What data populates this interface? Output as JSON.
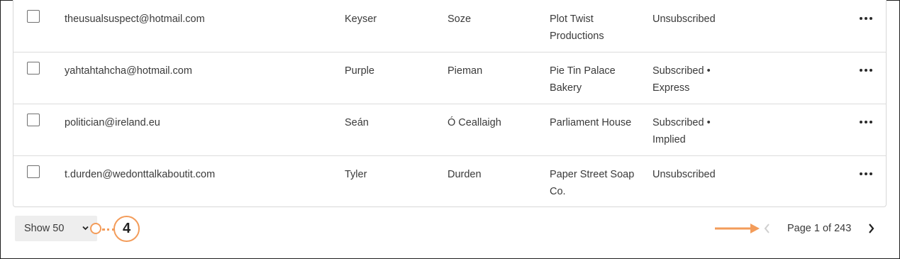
{
  "rows": [
    {
      "email": "theusualsuspect@hotmail.com",
      "first_name": "Keyser",
      "last_name": "Soze",
      "company": "Plot Twist Productions",
      "status": "Unsubscribed"
    },
    {
      "email": "yahtahtahcha@hotmail.com",
      "first_name": "Purple",
      "last_name": "Pieman",
      "company": "Pie Tin Palace Bakery",
      "status": "Subscribed • Express"
    },
    {
      "email": "politician@ireland.eu",
      "first_name": "Seán",
      "last_name": "Ó Ceallaigh",
      "company": "Parliament House",
      "status": "Subscribed • Implied"
    },
    {
      "email": "t.durden@wedonttalkaboutit.com",
      "first_name": "Tyler",
      "last_name": "Durden",
      "company": "Paper Street Soap Co.",
      "status": "Unsubscribed"
    }
  ],
  "pagination": {
    "show_label": "Show 50",
    "page_label": "Page 1 of 243"
  },
  "annotation": {
    "number": "4",
    "accent_color": "#f39c5a"
  },
  "icons": {
    "row_menu": "more-horizontal-icon",
    "select": "chevron-down-icon",
    "prev": "chevron-left-icon",
    "next": "chevron-right-icon",
    "pointer": "arrow-right-icon"
  }
}
